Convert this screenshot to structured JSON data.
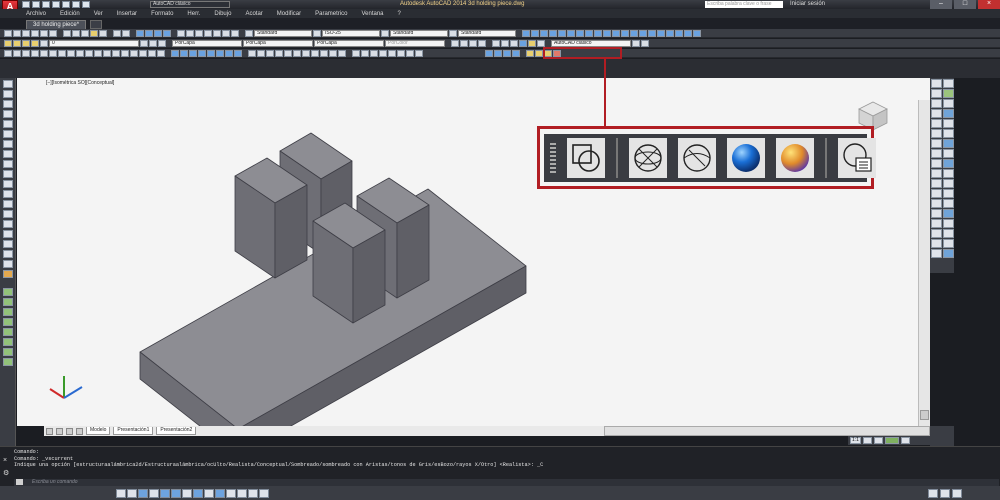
{
  "app": {
    "logo_letter": "A",
    "title": "Autodesk AutoCAD 2014   3d holding piece.dwg",
    "workspace": "AutoCAD clásico",
    "search_placeholder": "Escriba palabra clave o frase",
    "signin": "Iniciar sesión"
  },
  "menu": [
    "Archivo",
    "Edición",
    "Ver",
    "Insertar",
    "Formato",
    "Herr.",
    "Dibujo",
    "Acotar",
    "Modificar",
    "Parametrico",
    "Ventana",
    "?"
  ],
  "document_tab": "3d holding piece*",
  "toolbars": {
    "text_style": "Standard",
    "dim_style": "ISO-25",
    "table_style": "Standard",
    "mleader_style": "Standard",
    "layer": "0",
    "color": "PorCapa",
    "linetype": "PorCapa",
    "lineweight": "PorCapa",
    "plotstyle": "PorColor",
    "workspace": "AutoCAD clásico"
  },
  "viewport": {
    "label": "[−][Isométrica SO][Conceptual]"
  },
  "layout_tabs": [
    "Modelo",
    "Presentación1",
    "Presentación2"
  ],
  "status_right": {
    "scale": "1:1"
  },
  "command": {
    "lines": [
      "Comando:",
      "Comando:  _vscurrent",
      "Indique una opción [estructuraalámbrica2d/Estructuraalámbrica/ocUlto/Realista/Conceptual/Sombreado/sombreado con Aristas/tonos de Gris/esBozo/rayos X/Otro] <Realista>: _C"
    ],
    "input_placeholder": "Escriba un comando"
  },
  "visual_style_toolbar": {
    "buttons": [
      {
        "icon": "2d-wireframe-icon"
      },
      {
        "icon": "3d-wireframe-icon"
      },
      {
        "icon": "3d-hidden-icon"
      },
      {
        "icon": "realistic-icon",
        "color": "#1a6fd6"
      },
      {
        "icon": "conceptual-icon",
        "color": "#e08a2a"
      },
      {
        "icon": "visual-styles-manager-icon"
      }
    ],
    "highlight_color": "#b11d23"
  }
}
